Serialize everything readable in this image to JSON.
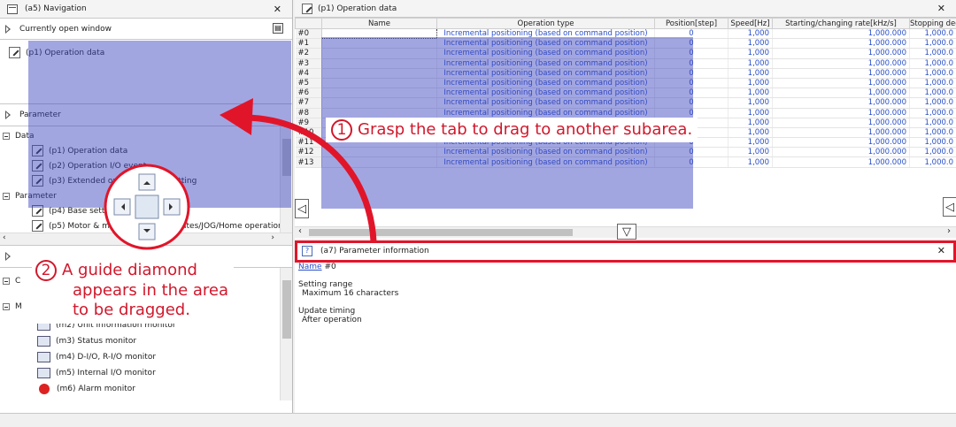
{
  "nav": {
    "title": "(a5) Navigation",
    "open_window_label": "Currently open window",
    "open_item": "(p1) Operation data",
    "parameter_section": "Parameter",
    "tree_data": "Data",
    "tree_data_items": [
      "(p1) Operation data",
      "(p2) Operation I/O event",
      "(p3) Extended operation data setting"
    ],
    "tree_parameter": "Parameter",
    "tree_parameter_items": [
      "(p4) Base setting",
      "(p5) Motor & mechanism/Coordinates/JOG/Home operation"
    ],
    "monitor_group_initial": "C",
    "monitor_group2_initial": "M",
    "monitor_items": [
      "(m2) Unit information monitor",
      "(m3) Status monitor",
      "(m4) D-I/O, R-I/O monitor",
      "(m5) Internal I/O monitor",
      "(m6) Alarm monitor"
    ]
  },
  "opdata": {
    "title": "(p1) Operation data",
    "columns": [
      "",
      "Name",
      "Operation type",
      "Position[step]",
      "Speed[Hz]",
      "Starting/changing rate[kHz/s]",
      "Stopping deceler"
    ],
    "row_ids": [
      "#0",
      "#1",
      "#2",
      "#3",
      "#4",
      "#5",
      "#6",
      "#7",
      "#8",
      "#9",
      "#10",
      "#11",
      "#12",
      "#13"
    ],
    "op_type": "Incremental positioning (based on command position)",
    "position": "0",
    "speed": "1,000",
    "rate": "1,000.000",
    "stop": "1,000.0"
  },
  "paraminfo": {
    "title": "(a7) Parameter information",
    "name_link": "Name",
    "name_value": "#0",
    "setting_range_label": "Setting range",
    "setting_range_value": "Maximum 16 characters",
    "update_label": "Update timing",
    "update_value": "After operation"
  },
  "callouts": {
    "one_number": "1",
    "one_text": "Grasp the tab to drag to another subarea.",
    "two_number": "2",
    "two_line1": "A guide diamond",
    "two_line2": "appears in the area",
    "two_line3": "to be dragged."
  },
  "colors": {
    "accent_red": "#e1152a",
    "overlay_blue": "#3c46be",
    "link_blue": "#2a50c8"
  }
}
